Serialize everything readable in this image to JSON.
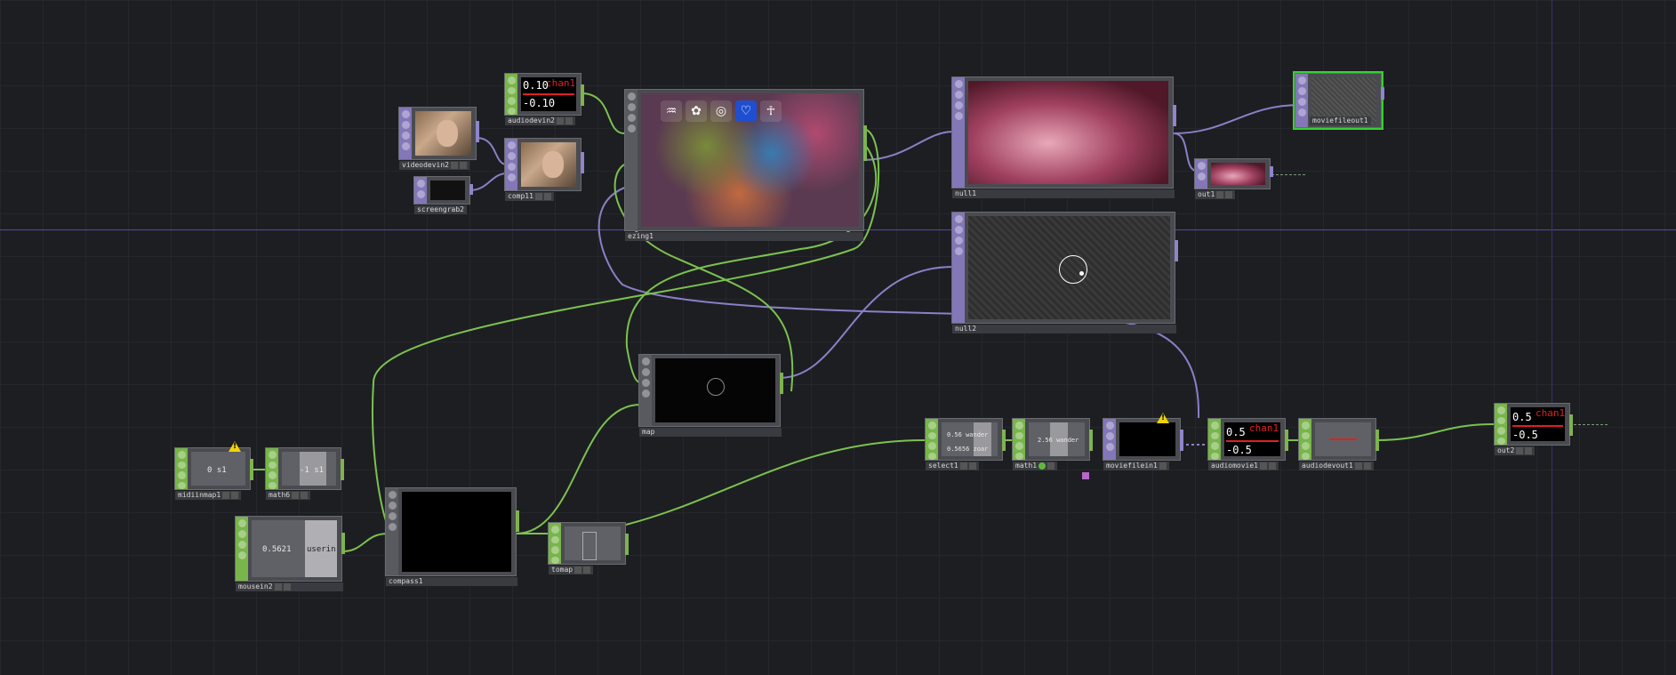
{
  "nodes": {
    "audiodevin2": {
      "label": "audiodevin2",
      "value_top": "0.10",
      "value_bottom": "-0.10",
      "red_text": "chan1"
    },
    "videodevin2": {
      "label": "videodevin2"
    },
    "comp11": {
      "label": "comp11"
    },
    "screengrab2": {
      "label": "screengrab2"
    },
    "ezing1": {
      "label": "ezing1",
      "icons": [
        "lungs-icon",
        "brain-icon",
        "target-icon",
        "heart-icon",
        "body-icon"
      ]
    },
    "null1": {
      "label": "null1"
    },
    "out1": {
      "label": "out1"
    },
    "moviefileout1": {
      "label": "moviefileout1"
    },
    "null2": {
      "label": "null2"
    },
    "map": {
      "label": "map"
    },
    "midiinmap1": {
      "label": "midiinmap1",
      "value": "0  s1"
    },
    "math6": {
      "label": "math6",
      "value": "-1  s1"
    },
    "mousein2": {
      "label": "mousein2",
      "value": "0.5621",
      "value2": "userin"
    },
    "compass1": {
      "label": "compass1"
    },
    "tomap": {
      "label": "tomap"
    },
    "select1": {
      "label": "select1",
      "value": "0.56  wander",
      "value2": "0.5656  zoar"
    },
    "math1": {
      "label": "math1",
      "value": "2.56  wander"
    },
    "moviefilein1": {
      "label": "moviefilein1"
    },
    "audiomovie1": {
      "label": "audiomovie1",
      "value_top": "0.5",
      "value_bottom": "-0.5",
      "red_text": "chan1"
    },
    "audiodevout1": {
      "label": "audiodevout1"
    },
    "out2": {
      "label": "out2",
      "value_top": "0.5",
      "value_bottom": "-0.5",
      "red_text": "chan1"
    }
  },
  "colors": {
    "background": "#1d1e22",
    "chop": "#78b54a",
    "top": "#8377b8",
    "chop_wire": "#7cc24f",
    "top_wire": "#8a80c8",
    "warning": "#f0d20a",
    "selected": "#36d130"
  }
}
